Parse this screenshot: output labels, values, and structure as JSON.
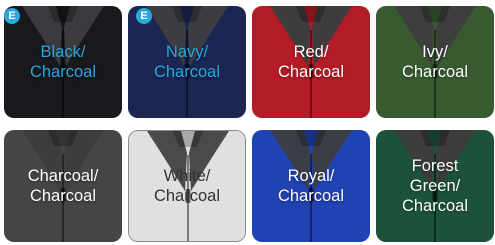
{
  "swatches": [
    {
      "label": "Black/\nCharcoal",
      "body": "#1b1c1f",
      "collar": "#3a3b3e",
      "label_color": "#29a8e0",
      "badge": "E"
    },
    {
      "label": "Navy/\nCharcoal",
      "body": "#1f2a5a",
      "collar": "#3b3d42",
      "label_color": "#29a8e0",
      "badge": "E"
    },
    {
      "label": "Red/\nCharcoal",
      "body": "#c31e2a",
      "collar": "#3e3c3d",
      "label_color": "#ffffff"
    },
    {
      "label": "Ivy/\nCharcoal",
      "body": "#3d6236",
      "collar": "#3d3f3c",
      "label_color": "#ffffff"
    },
    {
      "label": "Charcoal/\nCharcoal",
      "body": "#4a4b4d",
      "collar": "#3c3d3f",
      "label_color": "#ffffff"
    },
    {
      "label": "White/\nCharcoal",
      "body": "#f3f3f3",
      "collar": "#4a4a4c",
      "label_color": "#333333"
    },
    {
      "label": "Royal/\nCharcoal",
      "body": "#2448c2",
      "collar": "#3c3e45",
      "label_color": "#ffffff"
    },
    {
      "label": "Forest\nGreen/\nCharcoal",
      "body": "#1f5a3e",
      "collar": "#3a3d3c",
      "label_color": "#ffffff"
    }
  ]
}
